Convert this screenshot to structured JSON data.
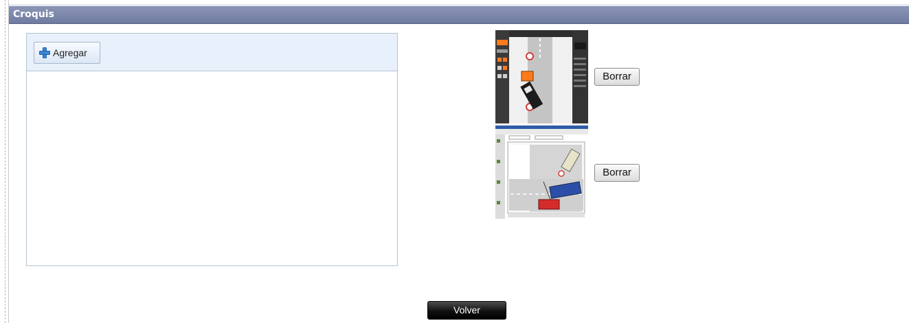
{
  "section": {
    "title": "Croquis"
  },
  "toolbar": {
    "add_label": "Agregar",
    "add_icon": "plus-icon"
  },
  "sketches": [
    {
      "delete_label": "Borrar"
    },
    {
      "delete_label": "Borrar"
    }
  ],
  "footer": {
    "back_label": "Volver"
  },
  "colors": {
    "header": "#7a85a8",
    "toolbar_bg": "#e8f0fb",
    "back_button": "#111111"
  }
}
